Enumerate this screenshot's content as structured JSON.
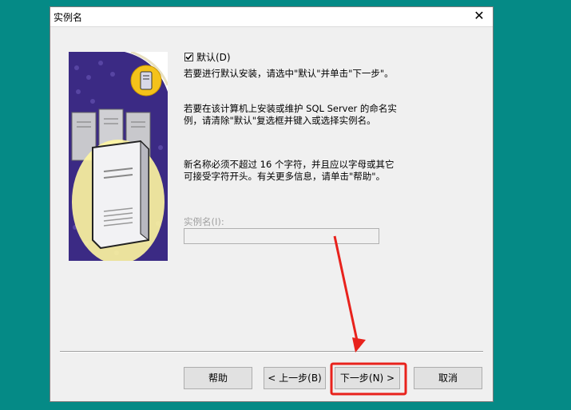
{
  "window": {
    "title": "实例名",
    "close_glyph": "✕"
  },
  "default_checkbox": {
    "label": "默认(D)",
    "checked": true
  },
  "instructions": {
    "p1": "若要进行默认安装，请选中\"默认\"并单击\"下一步\"。",
    "p2": "若要在该计算机上安装或维护 SQL Server 的命名实例，请清除\"默认\"复选框并键入或选择实例名。",
    "p3": "新名称必须不超过 16 个字符，并且应以字母或其它可接受字符开头。有关更多信息，请单击\"帮助\"。"
  },
  "instance_name": {
    "label": "实例名(I):",
    "value": "",
    "enabled": false
  },
  "buttons": {
    "help": "帮助",
    "back": "< 上一步(B)",
    "next": "下一步(N) >",
    "cancel": "取消"
  },
  "colors": {
    "desktop": "#058a86",
    "annotation": "#e8221c",
    "banner_purple": "#3b2a84"
  },
  "icons": [
    "server-graphic",
    "check-icon",
    "close-icon",
    "red-arrow"
  ]
}
